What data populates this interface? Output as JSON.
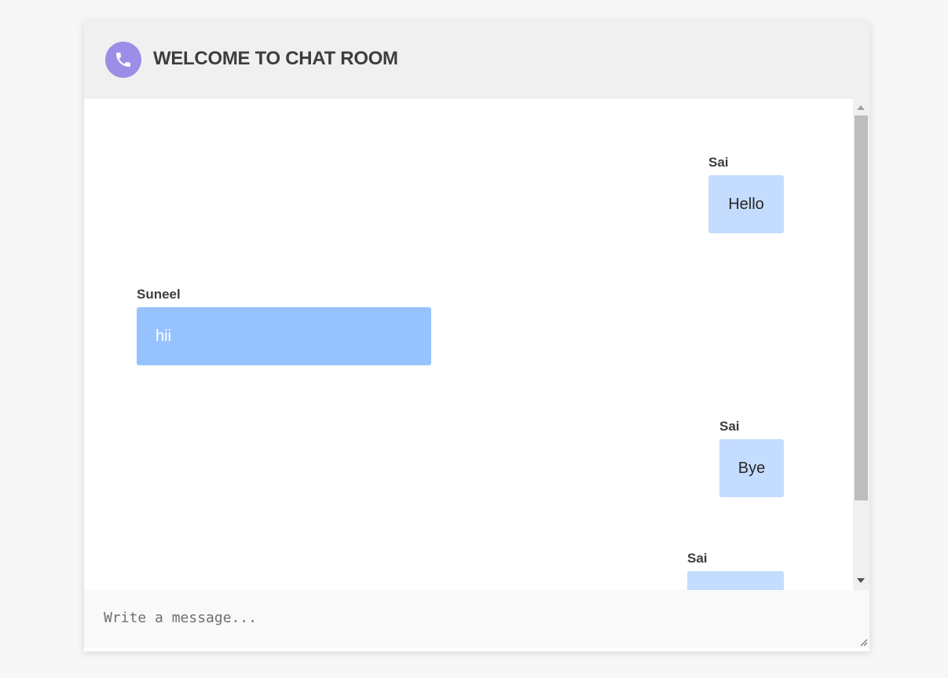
{
  "header": {
    "title": "WELCOME TO CHAT ROOM",
    "icon": "phone-icon",
    "icon_bg": "#9c8de6"
  },
  "messages": [
    {
      "sender": "Sai",
      "text": "Hello",
      "side": "right"
    },
    {
      "sender": "Suneel",
      "text": "hii",
      "side": "left"
    },
    {
      "sender": "Sai",
      "text": "Bye",
      "side": "right"
    },
    {
      "sender": "Sai",
      "text": "",
      "side": "right"
    }
  ],
  "composer": {
    "placeholder": "Write a message...",
    "value": ""
  },
  "colors": {
    "own_bubble": "#c4dcfd",
    "other_bubble": "#96c3fd",
    "header_bg": "#f0f0f0"
  }
}
